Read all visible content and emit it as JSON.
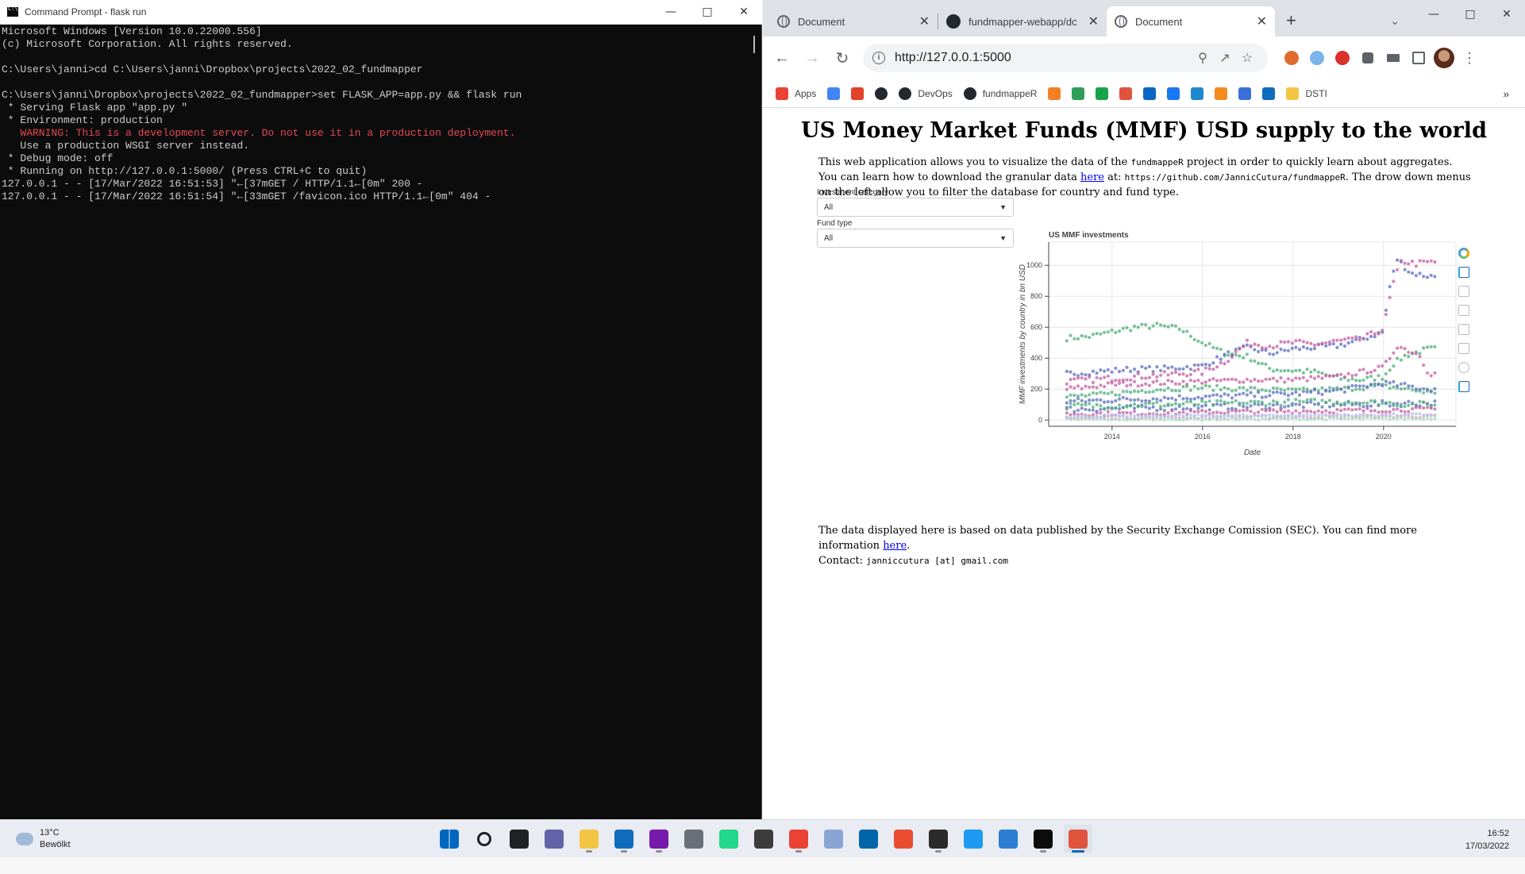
{
  "cmd": {
    "title": "Command Prompt - flask  run",
    "lines": [
      {
        "text": "Microsoft Windows [Version 10.0.22000.556]",
        "warn": false
      },
      {
        "text": "(c) Microsoft Corporation. All rights reserved.",
        "warn": false
      },
      {
        "text": "",
        "warn": false
      },
      {
        "text": "C:\\Users\\janni>cd C:\\Users\\janni\\Dropbox\\projects\\2022_02_fundmapper",
        "warn": false
      },
      {
        "text": "",
        "warn": false
      },
      {
        "text": "C:\\Users\\janni\\Dropbox\\projects\\2022_02_fundmapper>set FLASK_APP=app.py && flask run",
        "warn": false
      },
      {
        "text": " * Serving Flask app \"app.py \"",
        "warn": false
      },
      {
        "text": " * Environment: production",
        "warn": false
      },
      {
        "text": "   WARNING: This is a development server. Do not use it in a production deployment.",
        "warn": true
      },
      {
        "text": "   Use a production WSGI server instead.",
        "warn": false
      },
      {
        "text": " * Debug mode: off",
        "warn": false
      },
      {
        "text": " * Running on http://127.0.0.1:5000/ (Press CTRL+C to quit)",
        "warn": false
      },
      {
        "text": "127.0.0.1 - - [17/Mar/2022 16:51:53] \"←[37mGET / HTTP/1.1←[0m\" 200 -",
        "warn": false
      },
      {
        "text": "127.0.0.1 - - [17/Mar/2022 16:51:54] \"←[33mGET /favicon.ico HTTP/1.1←[0m\" 404 -",
        "warn": false
      }
    ]
  },
  "browser": {
    "tabs": [
      {
        "label": "Document",
        "icon": "globe-icon",
        "active": false
      },
      {
        "label": "fundmapper-webapp/dc",
        "icon": "github-icon",
        "active": false
      },
      {
        "label": "Document",
        "icon": "globe-icon",
        "active": true
      }
    ],
    "url": "http://127.0.0.1:5000",
    "bookmarks": [
      {
        "label": "Apps",
        "icon": "apps-grid-icon",
        "color": "#ea4335"
      },
      {
        "label": "",
        "icon": "google-icon",
        "color": "#4285f4"
      },
      {
        "label": "",
        "icon": "gitlab-icon",
        "color": "#e24329"
      },
      {
        "label": "",
        "icon": "github-icon",
        "color": "#24292f"
      },
      {
        "label": "DevOps",
        "icon": "github-icon",
        "color": "#24292f"
      },
      {
        "label": "fundmappeR",
        "icon": "github-icon",
        "color": "#24292f"
      },
      {
        "label": "",
        "icon": "stackoverflow-icon",
        "color": "#f48024"
      },
      {
        "label": "",
        "icon": "leaf-icon",
        "color": "#2e9e5a"
      },
      {
        "label": "",
        "icon": "one-icon",
        "color": "#17a34a"
      },
      {
        "label": "",
        "icon": "layers-icon",
        "color": "#e0533d"
      },
      {
        "label": "",
        "icon": "linkedin-icon",
        "color": "#0a66c2"
      },
      {
        "label": "",
        "icon": "facebook-icon",
        "color": "#1877f2"
      },
      {
        "label": "",
        "icon": "s-icon",
        "color": "#1f8acb"
      },
      {
        "label": "",
        "icon": "box-icon",
        "color": "#f58a1f"
      },
      {
        "label": "",
        "icon": "diamond-icon",
        "color": "#3a70d8"
      },
      {
        "label": "",
        "icon": "outlook-icon",
        "color": "#0f6cbd"
      },
      {
        "label": "DSTI",
        "icon": "folder-icon",
        "color": "#f4c542"
      }
    ],
    "more_label": "»"
  },
  "page": {
    "title": "US Money Market Funds (MMF) USD supply to the world",
    "intro": {
      "p1": "This web application allows you to visualize the data of the ",
      "code1": "fundmappeR",
      "p2": " project in order to quickly learn about aggregates. You can learn how to download the granular data ",
      "link": "here",
      "p3": " at: ",
      "code2": "https://github.com/JannicCutura/fundmappeR",
      "p4": ". The drow down menus on the left allow you to filter the database for country and fund type."
    },
    "filters": [
      {
        "label": "Investment category",
        "value": "All"
      },
      {
        "label": "Fund type",
        "value": "All"
      }
    ],
    "footer": {
      "text": "The data displayed here is based on data published by the Security Exchange Comission (SEC). You can find more information ",
      "link": "here",
      "end": ".",
      "contact_label": "Contact: ",
      "contact": "janniccutura [at] gmail.com"
    }
  },
  "chart_data": {
    "type": "scatter",
    "title": "US MMF investments",
    "xlabel": "Date",
    "ylabel": "MMF investments by country in bn USD",
    "xlim": [
      2012.6,
      2021.6
    ],
    "ylim": [
      -40,
      1150
    ],
    "xticks": [
      2014,
      2016,
      2018,
      2020
    ],
    "yticks": [
      0,
      200,
      400,
      600,
      800,
      1000
    ],
    "grid": true,
    "series": [
      {
        "color": "#4daf7c",
        "anchors": [
          [
            2013.0,
            530
          ],
          [
            2013.5,
            540
          ],
          [
            2014.0,
            570
          ],
          [
            2014.5,
            600
          ],
          [
            2015.0,
            610
          ],
          [
            2015.5,
            590
          ],
          [
            2016.0,
            500
          ],
          [
            2016.5,
            430
          ],
          [
            2017.0,
            410
          ],
          [
            2017.5,
            330
          ],
          [
            2018.0,
            320
          ],
          [
            2018.5,
            310
          ],
          [
            2019.0,
            270
          ],
          [
            2019.5,
            260
          ],
          [
            2020.0,
            280
          ],
          [
            2020.2,
            360
          ],
          [
            2020.5,
            420
          ],
          [
            2021.0,
            460
          ]
        ],
        "spread": 18
      },
      {
        "color": "#5b6cc2",
        "anchors": [
          [
            2013.0,
            300
          ],
          [
            2013.5,
            310
          ],
          [
            2014.0,
            320
          ],
          [
            2014.5,
            330
          ],
          [
            2015.0,
            330
          ],
          [
            2015.5,
            340
          ],
          [
            2016.0,
            350
          ],
          [
            2016.5,
            420
          ],
          [
            2017.0,
            470
          ],
          [
            2017.5,
            430
          ],
          [
            2018.0,
            460
          ],
          [
            2018.5,
            470
          ],
          [
            2019.0,
            480
          ],
          [
            2019.5,
            520
          ],
          [
            2020.0,
            570
          ],
          [
            2020.1,
            820
          ],
          [
            2020.3,
            1040
          ],
          [
            2020.6,
            950
          ],
          [
            2021.0,
            930
          ]
        ],
        "spread": 18
      },
      {
        "color": "#c45ea1",
        "anchors": [
          [
            2013.0,
            250
          ],
          [
            2013.5,
            260
          ],
          [
            2014.0,
            270
          ],
          [
            2014.5,
            280
          ],
          [
            2015.0,
            290
          ],
          [
            2015.5,
            300
          ],
          [
            2016.0,
            310
          ],
          [
            2016.5,
            380
          ],
          [
            2017.0,
            500
          ],
          [
            2017.5,
            480
          ],
          [
            2018.0,
            500
          ],
          [
            2018.5,
            490
          ],
          [
            2019.0,
            510
          ],
          [
            2019.5,
            520
          ],
          [
            2020.0,
            590
          ],
          [
            2020.2,
            870
          ],
          [
            2020.4,
            1030
          ],
          [
            2020.7,
            1010
          ],
          [
            2021.0,
            1020
          ]
        ],
        "spread": 20
      },
      {
        "color": "#c45ea1",
        "anchors": [
          [
            2013.0,
            200
          ],
          [
            2014.0,
            230
          ],
          [
            2015.0,
            240
          ],
          [
            2016.0,
            250
          ],
          [
            2017.0,
            260
          ],
          [
            2018.0,
            260
          ],
          [
            2019.0,
            280
          ],
          [
            2020.0,
            340
          ],
          [
            2020.3,
            480
          ],
          [
            2020.8,
            420
          ],
          [
            2021.0,
            300
          ]
        ],
        "spread": 16
      },
      {
        "color": "#4daf7c",
        "anchors": [
          [
            2013.0,
            150
          ],
          [
            2014.0,
            170
          ],
          [
            2015.0,
            200
          ],
          [
            2016.0,
            210
          ],
          [
            2017.0,
            200
          ],
          [
            2018.0,
            190
          ],
          [
            2019.0,
            200
          ],
          [
            2020.0,
            220
          ],
          [
            2021.0,
            180
          ]
        ],
        "spread": 16
      },
      {
        "color": "#5b6cc2",
        "anchors": [
          [
            2013.0,
            120
          ],
          [
            2014.0,
            130
          ],
          [
            2015.0,
            140
          ],
          [
            2016.0,
            150
          ],
          [
            2017.0,
            160
          ],
          [
            2018.0,
            170
          ],
          [
            2019.0,
            190
          ],
          [
            2020.0,
            240
          ],
          [
            2021.0,
            200
          ]
        ],
        "spread": 18
      },
      {
        "color": "#5b6cc2",
        "anchors": [
          [
            2013.0,
            70
          ],
          [
            2015.0,
            80
          ],
          [
            2017.0,
            90
          ],
          [
            2019.0,
            100
          ],
          [
            2021.0,
            110
          ]
        ],
        "spread": 20
      },
      {
        "color": "#4daf7c",
        "anchors": [
          [
            2013.0,
            90
          ],
          [
            2015.0,
            100
          ],
          [
            2017.0,
            110
          ],
          [
            2019.0,
            120
          ],
          [
            2021.0,
            100
          ]
        ],
        "spread": 20
      },
      {
        "color": "#c45ea1",
        "anchors": [
          [
            2013.0,
            40
          ],
          [
            2015.0,
            45
          ],
          [
            2017.0,
            55
          ],
          [
            2019.0,
            60
          ],
          [
            2021.0,
            70
          ]
        ],
        "spread": 14
      },
      {
        "color": "#e0a3c9",
        "anchors": [
          [
            2013.0,
            15
          ],
          [
            2021.0,
            25
          ]
        ],
        "spread": 10
      },
      {
        "color": "#a6d9bd",
        "anchors": [
          [
            2013.0,
            5
          ],
          [
            2021.0,
            10
          ]
        ],
        "spread": 6
      },
      {
        "color": "#b8c0ea",
        "anchors": [
          [
            2013.0,
            25
          ],
          [
            2021.0,
            35
          ]
        ],
        "spread": 8
      }
    ]
  },
  "taskbar": {
    "temp": "13°C",
    "weather": "Bewölkt",
    "time": "16:52",
    "date": "17/03/2022",
    "apps": [
      {
        "name": "windows-start-icon",
        "color": "#0067c0",
        "running": false
      },
      {
        "name": "search-icon",
        "color": "#202124",
        "running": false
      },
      {
        "name": "task-view-icon",
        "color": "#202124",
        "running": false
      },
      {
        "name": "teams-chat-icon",
        "color": "#6264a7",
        "running": false
      },
      {
        "name": "file-explorer-icon",
        "color": "#f4c542",
        "running": true
      },
      {
        "name": "outlook-icon",
        "color": "#0f6cbd",
        "running": true
      },
      {
        "name": "onenote-icon",
        "color": "#7719aa",
        "running": true
      },
      {
        "name": "app-grid-icon",
        "color": "#6a6f78",
        "running": false
      },
      {
        "name": "pycharm-icon",
        "color": "#21d789",
        "running": false
      },
      {
        "name": "app-icon",
        "color": "#3c3c3c",
        "running": false
      },
      {
        "name": "chrome-icon",
        "color": "#ea4335",
        "running": true
      },
      {
        "name": "r-icon",
        "color": "#8aa4d6",
        "running": false
      },
      {
        "name": "vscode-icon",
        "color": "#0065a9",
        "running": false
      },
      {
        "name": "git-icon",
        "color": "#e94e31",
        "running": false
      },
      {
        "name": "terminal-icon",
        "color": "#2b2b2b",
        "running": true
      },
      {
        "name": "docker-icon",
        "color": "#1d9bf0",
        "running": false
      },
      {
        "name": "notepad-icon",
        "color": "#2d7dd2",
        "running": false
      },
      {
        "name": "cmd-icon",
        "color": "#0c0c0c",
        "running": true
      },
      {
        "name": "snipping-tool-icon",
        "color": "#e0533d",
        "running": true,
        "focus": true
      }
    ]
  }
}
